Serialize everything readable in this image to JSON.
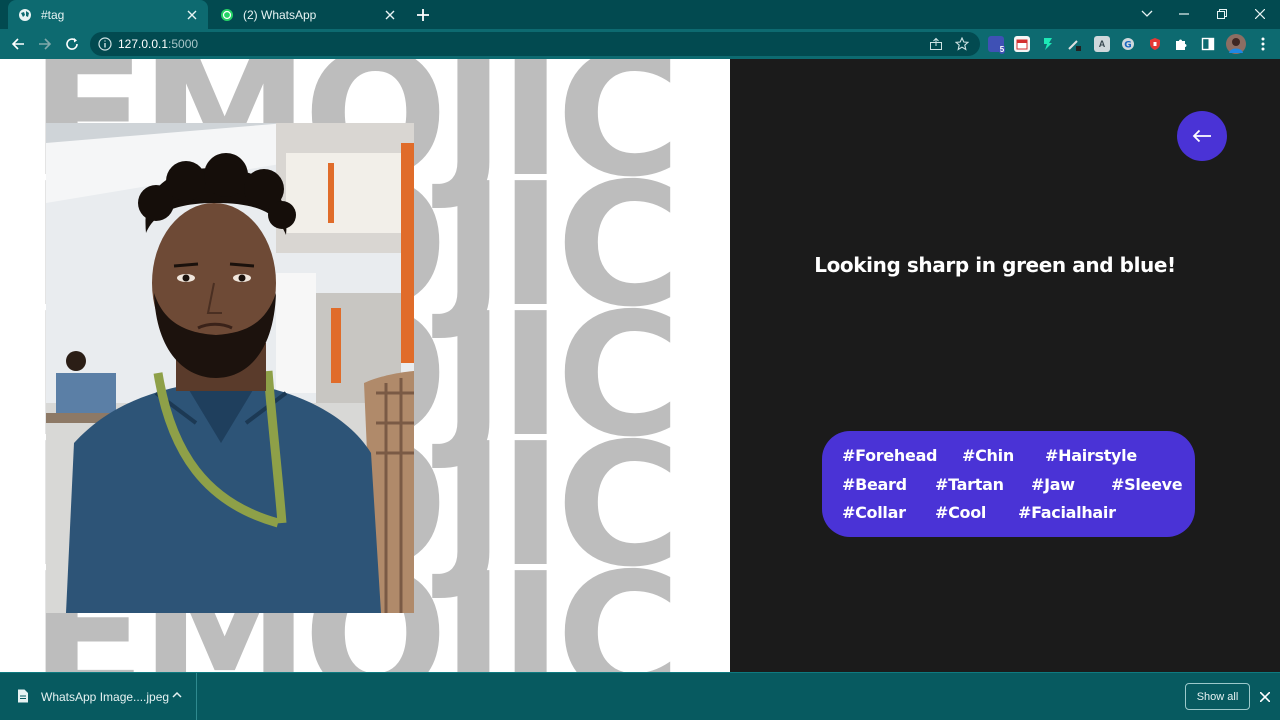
{
  "browser": {
    "tabs": [
      {
        "title": "#tag",
        "icon": "globe-icon",
        "active": true
      },
      {
        "title": "(2) WhatsApp",
        "icon": "whatsapp-icon",
        "active": false
      }
    ],
    "url_host": "127.0.0.1",
    "url_port": ":5000",
    "extension_badge": "5"
  },
  "page": {
    "background_word": "EMOJIC",
    "caption": "Looking sharp in green and blue!",
    "back_button_icon": "arrow-left-icon",
    "tags": [
      "#Forehead",
      "#Chin",
      "#Hairstyle",
      "#Beard",
      "#Tartan",
      "#Jaw",
      "#Sleeve",
      "#Collar",
      "#Cool",
      "#Facialhair"
    ],
    "colors": {
      "accent": "#4a33d6",
      "panel_dark": "#1b1b1b",
      "background_word": "#bdbdbd",
      "browser_frame": "#0d6a70"
    }
  },
  "download_bar": {
    "file_name": "WhatsApp Image....jpeg",
    "show_all_label": "Show all"
  }
}
